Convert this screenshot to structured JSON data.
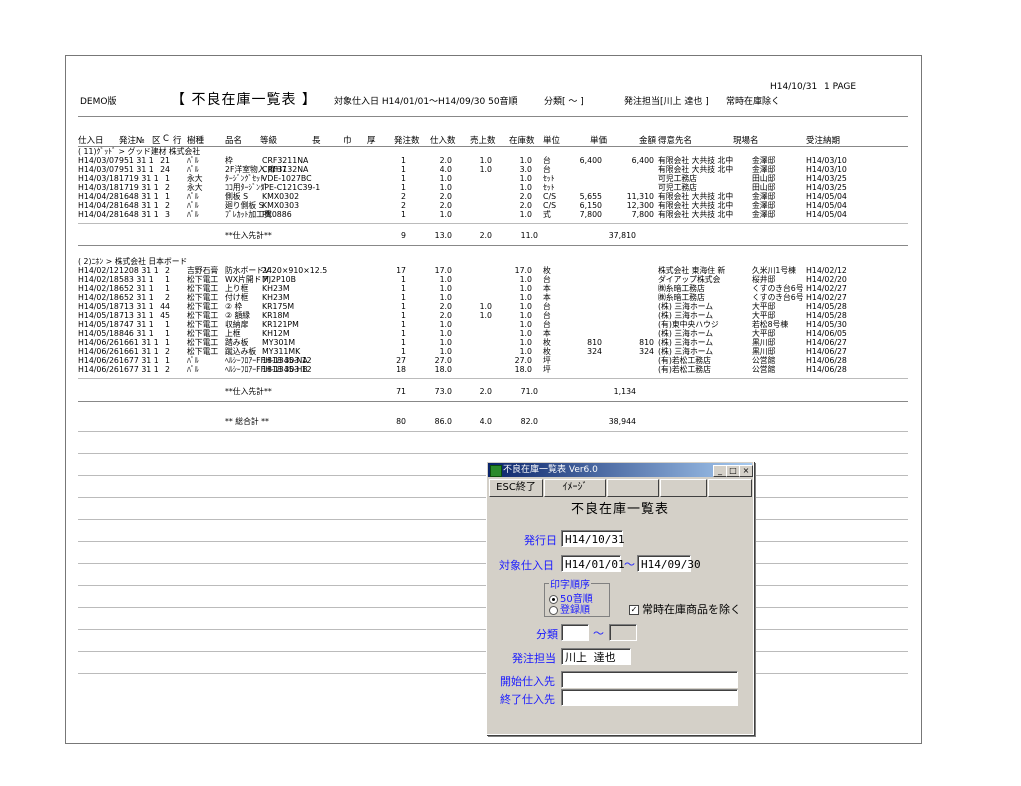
{
  "report": {
    "demo_label": "DEMO版",
    "title": "【 不良在庫一覧表 】",
    "target_range": "対象仕入日 H14/01/01～H14/09/30 50音順",
    "class_label": "分類[ ～ ]",
    "staff_label": "発注担当[川上 達也 ]",
    "exclude_label": "常時在庫除く",
    "date": "H14/10/31",
    "page": "1 PAGE"
  },
  "columns": [
    "仕入日",
    "発注№",
    "区",
    "C",
    "行",
    "樹種",
    "品名",
    "等級",
    "長",
    "巾",
    "厚",
    "発注数",
    "仕入数",
    "売上数",
    "在庫数",
    "単位",
    "単価",
    "金額",
    "得意先名",
    "現場名",
    "受注納期"
  ],
  "group1": {
    "header": "(     11)ｸﾞｯﾄﾞ > グッド建材 株式会社",
    "rows": [
      {
        "date": "H14/03/07",
        "no": "951 31 1",
        "line": "21",
        "sp": "ﾊﾟﾙ",
        "name": "枠",
        "grade": "CRF3211NA",
        "order": "1",
        "buy": "2.0",
        "sold": "1.0",
        "stock": "1.0",
        "unit": "台",
        "price": "6,400",
        "amount": "6,400",
        "cust": "有限会社 大共技 北中",
        "site": "金澤邸",
        "due": "H14/03/10"
      },
      {
        "date": "H14/03/07",
        "no": "951 31 1",
        "line": "24",
        "sp": "ﾊﾟﾙ",
        "name": "2F洋室物入 扉H7",
        "grade": "CRF3132NA",
        "order": "1",
        "buy": "4.0",
        "sold": "1.0",
        "stock": "3.0",
        "unit": "台",
        "price": "",
        "amount": "",
        "cust": "有限会社 大共技 北中",
        "site": "金澤邸",
        "due": "H14/03/10"
      },
      {
        "date": "H14/03/18",
        "no": "1719 31 1",
        "line": "1",
        "sp": "永大",
        "name": "ﾀｰｼﾞﾝｸﾞｾｯﾄ",
        "grade": "VDE-1027BC",
        "order": "1",
        "buy": "1.0",
        "sold": "",
        "stock": "1.0",
        "unit": "ｾｯﾄ",
        "price": "",
        "amount": "",
        "cust": "可児工務店",
        "site": "田山邸",
        "due": "H14/03/25"
      },
      {
        "date": "H14/03/18",
        "no": "1719 31 1",
        "line": "2",
        "sp": "永大",
        "name": "ｺｺ用ﾀｰｼﾞﾝｸﾞ",
        "grade": "IPE-C121C39-1",
        "order": "1",
        "buy": "1.0",
        "sold": "",
        "stock": "1.0",
        "unit": "ｾｯﾄ",
        "price": "",
        "amount": "",
        "cust": "可児工務店",
        "site": "田山邸",
        "due": "H14/03/25"
      },
      {
        "date": "H14/04/28",
        "no": "1648 31 1",
        "line": "1",
        "sp": "ﾊﾟﾙ",
        "name": "側板 S",
        "grade": "KMX0302",
        "order": "2",
        "buy": "2.0",
        "sold": "",
        "stock": "2.0",
        "unit": "C/S",
        "price": "5,655",
        "amount": "11,310",
        "cust": "有限会社 大共技 北中",
        "site": "金澤邸",
        "due": "H14/05/04"
      },
      {
        "date": "H14/04/28",
        "no": "1648 31 1",
        "line": "2",
        "sp": "ﾊﾟﾙ",
        "name": "廻り側板 S",
        "grade": "KMX0303",
        "order": "2",
        "buy": "2.0",
        "sold": "",
        "stock": "2.0",
        "unit": "C/S",
        "price": "6,150",
        "amount": "12,300",
        "cust": "有限会社 大共技 北中",
        "site": "金澤邸",
        "due": "H14/05/04"
      },
      {
        "date": "H14/04/28",
        "no": "1648 31 1",
        "line": "3",
        "sp": "ﾊﾟﾙ",
        "name": "ﾌﾟﾚｶｯﾄ加工費",
        "grade": "PK0886",
        "order": "1",
        "buy": "1.0",
        "sold": "",
        "stock": "1.0",
        "unit": "式",
        "price": "7,800",
        "amount": "7,800",
        "cust": "有限会社 大共技 北中",
        "site": "金澤邸",
        "due": "H14/05/04"
      }
    ],
    "subtotal": {
      "label": "**仕入先計**",
      "order": "9",
      "buy": "13.0",
      "sold": "2.0",
      "stock": "11.0",
      "amount": "37,810"
    }
  },
  "group2": {
    "header": "(      2)ﾆﾎﾝ > 株式会社 日本ボード",
    "rows": [
      {
        "date": "H14/02/12",
        "no": "1208 31 1",
        "line": "2",
        "sp": "吉野石膏",
        "name": "防水ボードV",
        "grade": "2420×910×12.5",
        "order": "17",
        "buy": "17.0",
        "sold": "",
        "stock": "17.0",
        "unit": "枚",
        "price": "",
        "amount": "",
        "cust": "株式会社 東海住 新",
        "site": "久米川1号棟",
        "due": "H14/02/12"
      },
      {
        "date": "H14/02/18",
        "no": "583 31 1",
        "line": "1",
        "sp": "松下電工",
        "name": "WX片開ドア",
        "grade": "MJ2P10B",
        "order": "1",
        "buy": "1.0",
        "sold": "",
        "stock": "1.0",
        "unit": "台",
        "price": "",
        "amount": "",
        "cust": "ダイアップ株式会",
        "site": "桜井邸",
        "due": "H14/02/20"
      },
      {
        "date": "H14/02/18",
        "no": "652 31 1",
        "line": "1",
        "sp": "松下電工",
        "name": "上り框",
        "grade": "KH23M",
        "order": "1",
        "buy": "1.0",
        "sold": "",
        "stock": "1.0",
        "unit": "本",
        "price": "",
        "amount": "",
        "cust": "㈱糸暗工務店",
        "site": "くすのき台6号",
        "due": "H14/02/27"
      },
      {
        "date": "H14/02/18",
        "no": "652 31 1",
        "line": "2",
        "sp": "松下電工",
        "name": "付け框",
        "grade": "KH23M",
        "order": "1",
        "buy": "1.0",
        "sold": "",
        "stock": "1.0",
        "unit": "本",
        "price": "",
        "amount": "",
        "cust": "㈱糸暗工務店",
        "site": "くすのき台6号",
        "due": "H14/02/27"
      },
      {
        "date": "H14/05/18",
        "no": "713 31 1",
        "line": "44",
        "sp": "松下電工",
        "name": "② 枠",
        "grade": "KR175M",
        "order": "1",
        "buy": "2.0",
        "sold": "1.0",
        "stock": "1.0",
        "unit": "台",
        "price": "",
        "amount": "",
        "cust": "(株) 三海ホーム",
        "site": "大平邸",
        "due": "H14/05/28"
      },
      {
        "date": "H14/05/18",
        "no": "713 31 1",
        "line": "45",
        "sp": "松下電工",
        "name": "② 額縁",
        "grade": "KR18M",
        "order": "1",
        "buy": "2.0",
        "sold": "1.0",
        "stock": "1.0",
        "unit": "台",
        "price": "",
        "amount": "",
        "cust": "(株) 三海ホーム",
        "site": "大平邸",
        "due": "H14/05/28"
      },
      {
        "date": "H14/05/18",
        "no": "747 31 1",
        "line": "1",
        "sp": "松下電工",
        "name": "収納扉",
        "grade": "KR121PM",
        "order": "1",
        "buy": "1.0",
        "sold": "",
        "stock": "1.0",
        "unit": "台",
        "price": "",
        "amount": "",
        "cust": "(有)東中央ハウジ",
        "site": "若松8号棟",
        "due": "H14/05/30"
      },
      {
        "date": "H14/05/18",
        "no": "846 31 1",
        "line": "1",
        "sp": "松下電工",
        "name": "上框",
        "grade": "KH12M",
        "order": "1",
        "buy": "1.0",
        "sold": "",
        "stock": "1.0",
        "unit": "本",
        "price": "",
        "amount": "",
        "cust": "(株) 三海ホーム",
        "site": "大平邸",
        "due": "H14/06/05"
      },
      {
        "date": "H14/06/26",
        "no": "1661 31 1",
        "line": "1",
        "sp": "松下電工",
        "name": "踏み板",
        "grade": "MY301M",
        "order": "1",
        "buy": "1.0",
        "sold": "",
        "stock": "1.0",
        "unit": "枚",
        "price": "810",
        "amount": "810",
        "cust": "(株) 三海ホーム",
        "site": "黒川邸",
        "due": "H14/06/27"
      },
      {
        "date": "H14/06/26",
        "no": "1661 31 1",
        "line": "2",
        "sp": "松下電工",
        "name": "蹴込み板",
        "grade": "MY311MK",
        "order": "1",
        "buy": "1.0",
        "sold": "",
        "stock": "1.0",
        "unit": "枚",
        "price": "324",
        "amount": "324",
        "cust": "(株) 三海ホーム",
        "site": "黒川邸",
        "due": "H14/06/27"
      },
      {
        "date": "H14/06/26",
        "no": "1677 31 1",
        "line": "1",
        "sp": "ﾊﾟﾙ",
        "name": "ﾍﾙｼｰﾌﾛｱｰFFH-1345-NA",
        "grade": "1818 303 12",
        "order": "27",
        "buy": "27.0",
        "sold": "",
        "stock": "27.0",
        "unit": "坪",
        "price": "",
        "amount": "",
        "cust": "(有)若松工務店",
        "site": "公営館",
        "due": "H14/06/28"
      },
      {
        "date": "H14/06/26",
        "no": "1677 31 1",
        "line": "2",
        "sp": "ﾊﾟﾙ",
        "name": "ﾍﾙｼｰﾌﾛｱｰFFH-1345-HB",
        "grade": "1818 303 12",
        "order": "18",
        "buy": "18.0",
        "sold": "",
        "stock": "18.0",
        "unit": "坪",
        "price": "",
        "amount": "",
        "cust": "(有)若松工務店",
        "site": "公営館",
        "due": "H14/06/28"
      }
    ],
    "subtotal": {
      "label": "**仕入先計**",
      "order": "71",
      "buy": "73.0",
      "sold": "2.0",
      "stock": "71.0",
      "amount": "1,134"
    }
  },
  "grand_total": {
    "label": "** 総合計 **",
    "order": "80",
    "buy": "86.0",
    "sold": "4.0",
    "stock": "82.0",
    "amount": "38,944"
  },
  "dialog": {
    "title": "不良在庫一覧表 Ver6.0",
    "esc_button": "ESC終了",
    "image_button": "ｲﾒｰｼﾞ",
    "heading": "不良在庫一覧表",
    "issue_date_label": "発行日",
    "issue_date_value": "H14/10/31",
    "target_label": "対象仕入日",
    "target_from": "H14/01/01",
    "tilde": "～",
    "target_to": "H14/09/30",
    "sort_group": "印字順序",
    "sort_opt1": "50音順",
    "sort_opt2": "登録順",
    "exclude_checkbox": "常時在庫商品を除く",
    "class_label": "分類",
    "staff_label": "発注担当",
    "staff_value": "川上 達也",
    "start_supplier": "開始仕入先",
    "end_supplier": "終了仕入先"
  }
}
